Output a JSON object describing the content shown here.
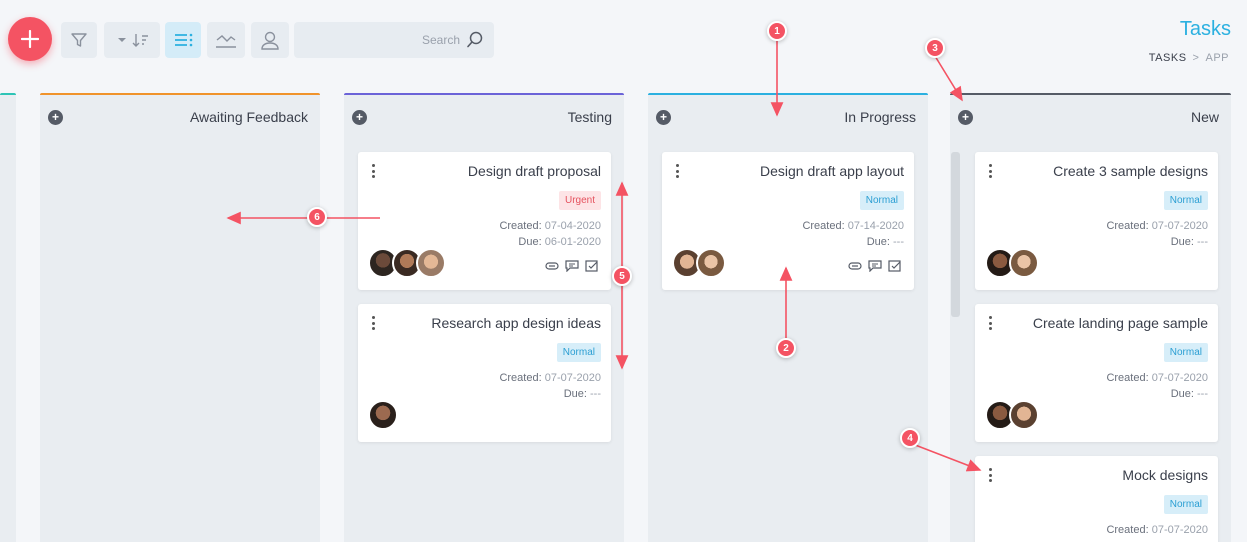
{
  "header": {
    "title": "Tasks",
    "breadcrumb": {
      "app": "APP",
      "separator": ">",
      "current": "TASKS"
    }
  },
  "toolbar": {
    "add_icon": "plus-icon",
    "search": {
      "placeholder": "Search",
      "icon": "search-icon"
    },
    "buttons": [
      "user-icon",
      "chart-icon",
      "list-icon",
      "sort-icon",
      "filter-icon"
    ]
  },
  "columns": [
    {
      "title": "New",
      "color": "#555b66",
      "cards": [
        {
          "title": "Create 3 sample designs",
          "priority": "Normal",
          "created_label": "Created:",
          "created": "07-07-2020",
          "due_label": "Due:",
          "due": "---"
        },
        {
          "title": "Create landing page sample",
          "priority": "Normal",
          "created_label": "Created:",
          "created": "07-07-2020",
          "due_label": "Due:",
          "due": "---"
        },
        {
          "title": "Mock designs",
          "priority": "Normal",
          "created_label": "Created:",
          "created": "07-07-2020"
        }
      ]
    },
    {
      "title": "In Progress",
      "color": "#2bb0e0",
      "cards": [
        {
          "title": "Design draft app layout",
          "priority": "Normal",
          "created_label": "Created:",
          "created": "07-14-2020",
          "due_label": "Due:",
          "due": "---"
        }
      ]
    },
    {
      "title": "Testing",
      "color": "#6b63d8",
      "cards": [
        {
          "title": "Design draft proposal",
          "priority": "Urgent",
          "created_label": "Created:",
          "created": "07-04-2020",
          "due_label": "Due:",
          "due": "06-01-2020"
        },
        {
          "title": "Research app design ideas",
          "priority": "Normal",
          "created_label": "Created:",
          "created": "07-07-2020",
          "due_label": "Due:",
          "due": "---"
        }
      ]
    },
    {
      "title": "Awaiting Feedback",
      "color": "#f0932b",
      "cards": []
    }
  ],
  "annotations": [
    "1",
    "2",
    "3",
    "4",
    "5",
    "6"
  ],
  "colors": {
    "accent": "#2bb0e0",
    "danger": "#f45363",
    "annotation": "#f45363"
  }
}
